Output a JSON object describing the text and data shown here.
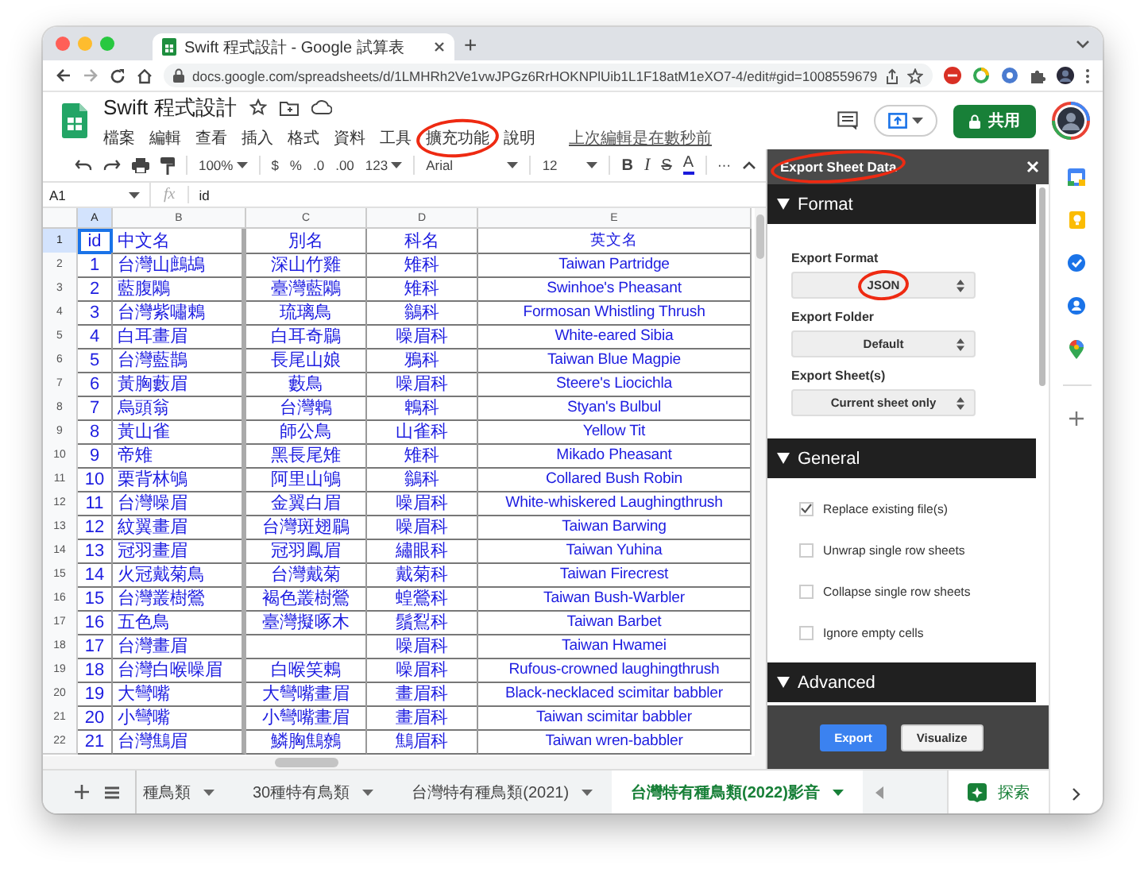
{
  "browser": {
    "tab_title": "Swift 程式設計 - Google 試算表",
    "new_tab": "+",
    "url": "docs.google.com/spreadsheets/d/1LMHRh2Ve1vwJPGz6RrHOKNPlUib1L1F18atM1eXO7-4/edit#gid=1008559679"
  },
  "document": {
    "title": "Swift 程式設計",
    "menus": [
      {
        "label": "檔案",
        "circled": false
      },
      {
        "label": "編輯",
        "circled": false
      },
      {
        "label": "查看",
        "circled": false
      },
      {
        "label": "插入",
        "circled": false
      },
      {
        "label": "格式",
        "circled": false
      },
      {
        "label": "資料",
        "circled": false
      },
      {
        "label": "工具",
        "circled": false
      },
      {
        "label": "擴充功能",
        "circled": true
      },
      {
        "label": "說明",
        "circled": false
      }
    ],
    "last_edit": "上次編輯是在數秒前",
    "share_label": "共用"
  },
  "toolbar": {
    "zoom": "100%",
    "currency": "$",
    "percent": "%",
    "decrease_decimals": ".0",
    "increase_decimals": ".00",
    "number_format": "123",
    "font": "Arial",
    "font_size": "12",
    "bold": "B",
    "italic": "I",
    "strikethrough": "S",
    "text_color": "A",
    "more": "⋯"
  },
  "formula_bar": {
    "cell_ref": "A1",
    "fx": "fx",
    "value": "id"
  },
  "grid": {
    "columns": [
      {
        "label": "A",
        "selected": true
      },
      {
        "label": "B",
        "selected": false
      },
      {
        "label": "C",
        "selected": false
      },
      {
        "label": "D",
        "selected": false
      },
      {
        "label": "E",
        "selected": false
      }
    ],
    "rows": [
      {
        "row": "1",
        "selected": true,
        "A": "id",
        "B": "中文名",
        "C": "別名",
        "D": "科名",
        "E": "英文名"
      },
      {
        "row": "2",
        "selected": false,
        "A": "1",
        "B": "台灣山鷓鴣",
        "C": "深山竹雞",
        "D": "雉科",
        "E": "Taiwan Partridge"
      },
      {
        "row": "3",
        "selected": false,
        "A": "2",
        "B": "藍腹鷴",
        "C": "臺灣藍鷴",
        "D": "雉科",
        "E": "Swinhoe's Pheasant"
      },
      {
        "row": "4",
        "selected": false,
        "A": "3",
        "B": "台灣紫嘯鶇",
        "C": "琉璃鳥",
        "D": "鶲科",
        "E": "Formosan Whistling Thrush"
      },
      {
        "row": "5",
        "selected": false,
        "A": "4",
        "B": "白耳畫眉",
        "C": "白耳奇鶥",
        "D": "噪眉科",
        "E": "White-eared Sibia"
      },
      {
        "row": "6",
        "selected": false,
        "A": "5",
        "B": "台灣藍鵲",
        "C": "長尾山娘",
        "D": "鴉科",
        "E": "Taiwan Blue Magpie"
      },
      {
        "row": "7",
        "selected": false,
        "A": "6",
        "B": "黃胸藪眉",
        "C": "藪鳥",
        "D": "噪眉科",
        "E": "Steere's Liocichla"
      },
      {
        "row": "8",
        "selected": false,
        "A": "7",
        "B": "烏頭翁",
        "C": "台灣鵯",
        "D": "鵯科",
        "E": "Styan's Bulbul"
      },
      {
        "row": "9",
        "selected": false,
        "A": "8",
        "B": "黃山雀",
        "C": "師公鳥",
        "D": "山雀科",
        "E": "Yellow Tit"
      },
      {
        "row": "10",
        "selected": false,
        "A": "9",
        "B": "帝雉",
        "C": "黑長尾雉",
        "D": "雉科",
        "E": "Mikado Pheasant"
      },
      {
        "row": "11",
        "selected": false,
        "A": "10",
        "B": "栗背林鴝",
        "C": "阿里山鴝",
        "D": "鶲科",
        "E": "Collared Bush Robin"
      },
      {
        "row": "12",
        "selected": false,
        "A": "11",
        "B": "台灣噪眉",
        "C": "金翼白眉",
        "D": "噪眉科",
        "E": "White-whiskered Laughingthrush"
      },
      {
        "row": "13",
        "selected": false,
        "A": "12",
        "B": "紋翼畫眉",
        "C": "台灣斑翅鶥",
        "D": "噪眉科",
        "E": "Taiwan Barwing"
      },
      {
        "row": "14",
        "selected": false,
        "A": "13",
        "B": "冠羽畫眉",
        "C": "冠羽鳳眉",
        "D": "繡眼科",
        "E": "Taiwan Yuhina"
      },
      {
        "row": "15",
        "selected": false,
        "A": "14",
        "B": "火冠戴菊鳥",
        "C": "台灣戴菊",
        "D": "戴菊科",
        "E": "Taiwan Firecrest"
      },
      {
        "row": "16",
        "selected": false,
        "A": "15",
        "B": "台灣叢樹鶯",
        "C": "褐色叢樹鶯",
        "D": "蝗鶯科",
        "E": "Taiwan Bush-Warbler"
      },
      {
        "row": "17",
        "selected": false,
        "A": "16",
        "B": "五色鳥",
        "C": "臺灣擬啄木",
        "D": "鬚鴷科",
        "E": "Taiwan Barbet"
      },
      {
        "row": "18",
        "selected": false,
        "A": "17",
        "B": "台灣畫眉",
        "D": "噪眉科",
        "E": "Taiwan Hwamei"
      },
      {
        "row": "19",
        "selected": false,
        "A": "18",
        "B": "台灣白喉噪眉",
        "C": "白喉笑鶇",
        "D": "噪眉科",
        "E": "Rufous-crowned laughingthrush"
      },
      {
        "row": "20",
        "selected": false,
        "A": "19",
        "B": "大彎嘴",
        "C": "大彎嘴畫眉",
        "D": "畫眉科",
        "E": "Black-necklaced scimitar babbler"
      },
      {
        "row": "21",
        "selected": false,
        "A": "20",
        "B": "小彎嘴",
        "C": "小彎嘴畫眉",
        "D": "畫眉科",
        "E": "Taiwan scimitar babbler"
      },
      {
        "row": "22",
        "selected": false,
        "A": "21",
        "B": "台灣鷦眉",
        "C": "鱗胸鷦鷯",
        "D": "鷦眉科",
        "E": "Taiwan wren-babbler"
      }
    ]
  },
  "sheet_tabs": [
    {
      "label": "種鳥類",
      "selected": false
    },
    {
      "label": "30種特有鳥類",
      "selected": false
    },
    {
      "label": "台灣特有種鳥類(2021)",
      "selected": false
    },
    {
      "label": "台灣特有種鳥類(2022)影音",
      "selected": true
    }
  ],
  "explore_label": "探索",
  "panel": {
    "title": "Export Sheet Data",
    "title_circled": true,
    "sections": [
      {
        "kind": "fields",
        "title": "Format",
        "fields": [
          {
            "label": "Export Format",
            "value": "JSON",
            "circled": true
          },
          {
            "label": "Export Folder",
            "value": "Default",
            "circled": false
          },
          {
            "label": "Export Sheet(s)",
            "value": "Current sheet only",
            "circled": false
          }
        ]
      },
      {
        "kind": "options",
        "title": "General",
        "options": [
          {
            "label": "Replace existing file(s)",
            "checked": true
          },
          {
            "label": "Unwrap single row sheets",
            "checked": false
          },
          {
            "label": "Collapse single row sheets",
            "checked": false
          },
          {
            "label": "Ignore empty cells",
            "checked": false
          }
        ]
      },
      {
        "kind": "empty",
        "title": "Advanced"
      }
    ],
    "buttons": [
      {
        "label": "Export",
        "kind": "primary"
      },
      {
        "label": "Visualize",
        "kind": "secondary"
      }
    ]
  }
}
